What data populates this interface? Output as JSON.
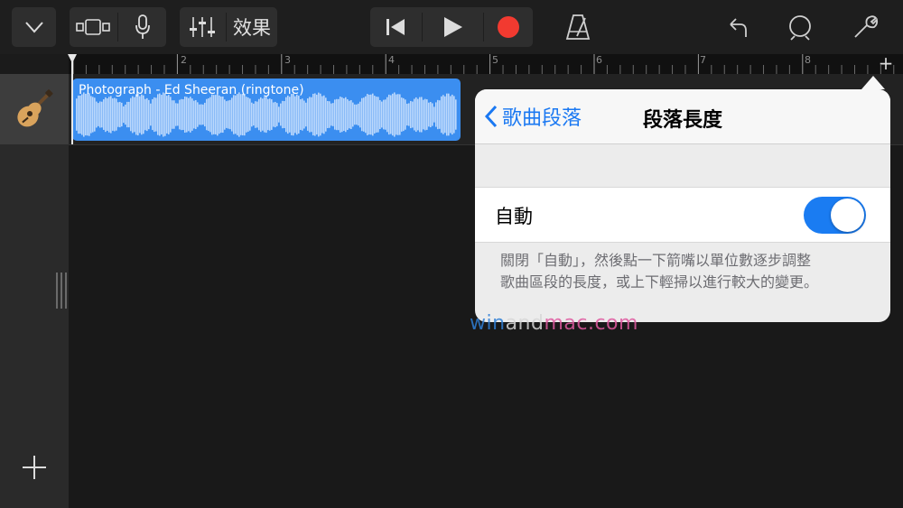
{
  "toolbar": {
    "fx_label": "效果",
    "colors": {
      "record": "#f23a30",
      "bg": "#2e2e2e"
    }
  },
  "ruler": {
    "markers": [
      "2",
      "3",
      "4",
      "5",
      "6",
      "7",
      "8"
    ],
    "add_label": "+"
  },
  "track": {
    "instrument_icon": "acoustic-guitar-icon",
    "region_title": "Photograph - Ed Sheeran (ringtone)",
    "region_color": "#3b8ef0"
  },
  "popover": {
    "back_label": "歌曲段落",
    "title": "段落長度",
    "auto_label": "自動",
    "auto_enabled": true,
    "footer_line1": "關閉「自動」，然後點一下箭嘴以單位數逐步調整",
    "footer_line2": "歌曲區段的長度，或上下輕掃以進行較大的變更。",
    "accent": "#1a78f2"
  },
  "watermark": {
    "part1": "win",
    "part2": "and",
    "part3": "mac.com"
  }
}
